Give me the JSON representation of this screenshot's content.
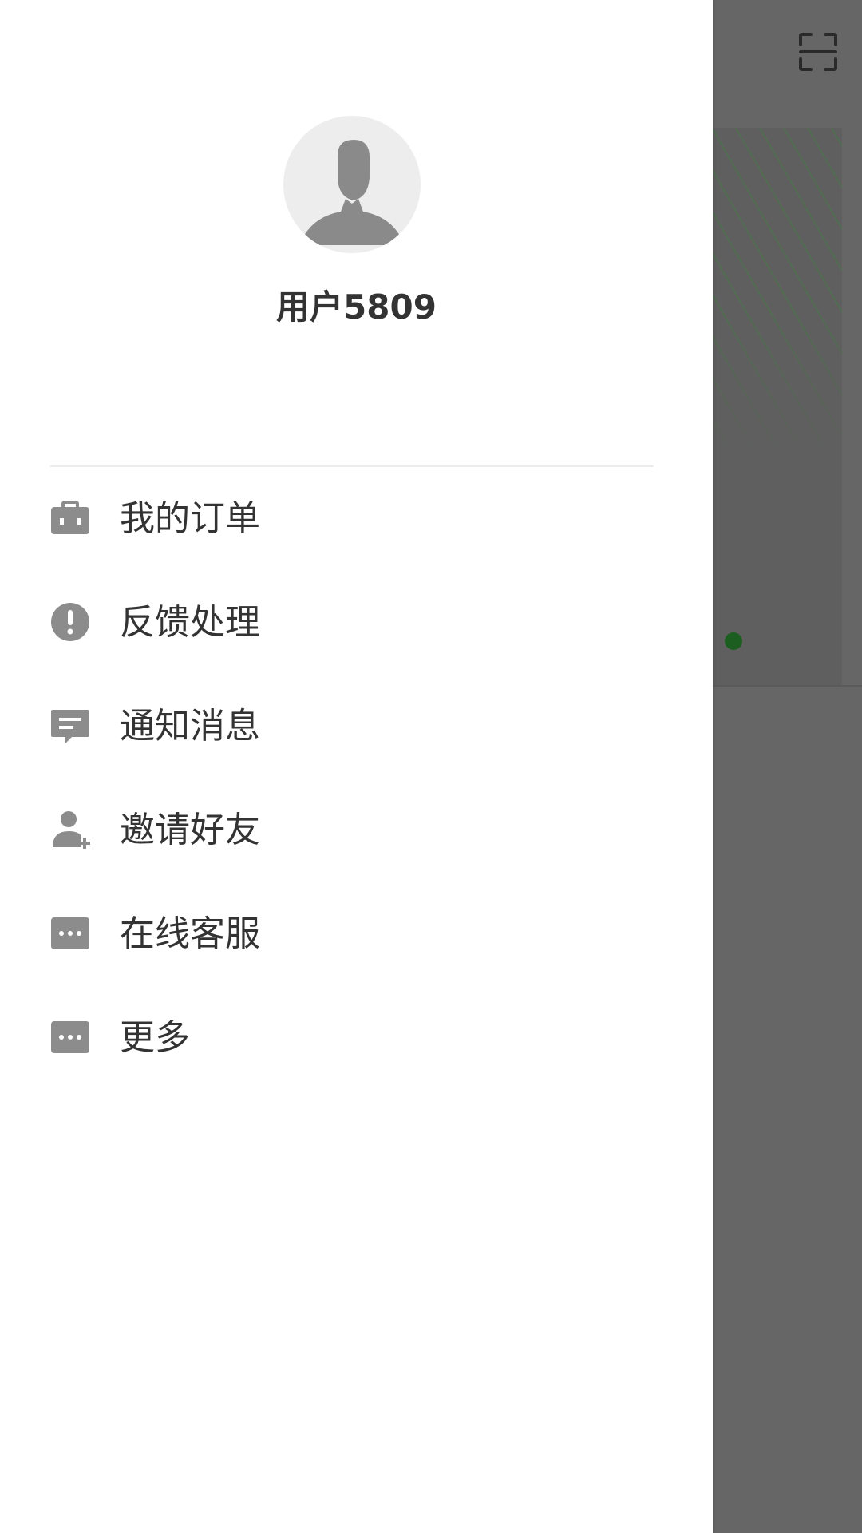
{
  "user": {
    "name": "用户5809"
  },
  "menu": {
    "items": [
      {
        "label": "我的订单",
        "icon": "briefcase-icon"
      },
      {
        "label": "反馈处理",
        "icon": "alert-circle-icon"
      },
      {
        "label": "通知消息",
        "icon": "message-icon"
      },
      {
        "label": "邀请好友",
        "icon": "add-person-icon"
      },
      {
        "label": "在线客服",
        "icon": "chat-dots-icon"
      },
      {
        "label": "更多",
        "icon": "more-dots-icon"
      }
    ]
  },
  "colors": {
    "icon_gray": "#8c8c8c",
    "overlay": "#666666",
    "accent_green": "#1b5e20"
  }
}
